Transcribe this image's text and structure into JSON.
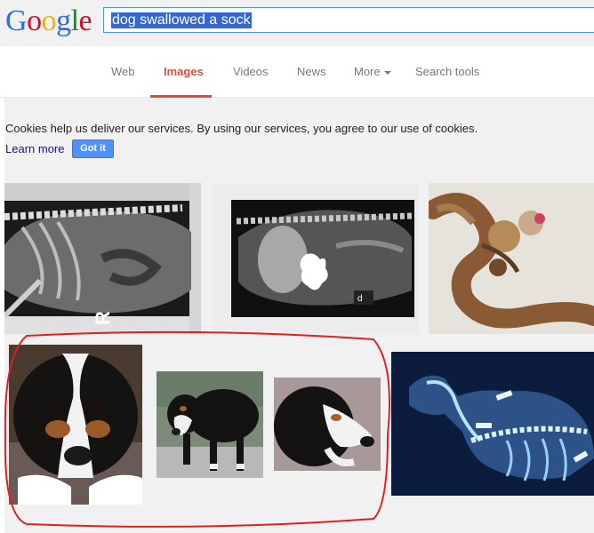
{
  "header": {
    "logo": {
      "G": "G",
      "o1": "o",
      "o2": "o",
      "g": "g",
      "l": "l",
      "e": "e"
    },
    "search": {
      "value": "dog swallowed a sock"
    }
  },
  "nav": {
    "items": [
      {
        "label": "Web"
      },
      {
        "label": "Images",
        "active": true
      },
      {
        "label": "Videos"
      },
      {
        "label": "News"
      },
      {
        "label": "More"
      },
      {
        "label": "Search tools"
      }
    ]
  },
  "cookie_notice": {
    "text": "Cookies help us deliver our services. By using our services, you agree to our use of cookies.",
    "learn_more": "Learn more",
    "got_it": "Got it"
  },
  "colors": {
    "accent_red": "#dd4b39",
    "link_blue": "#1a0dab",
    "button_blue": "#4d90fe",
    "annotation_red": "#e02020"
  },
  "results": [
    {
      "subject": "dog x-ray side view"
    },
    {
      "subject": "x-ray with sock mass"
    },
    {
      "subject": "extracted sock"
    },
    {
      "subject": "bernese puppy closeup"
    },
    {
      "subject": "bernese dog standing"
    },
    {
      "subject": "bernese dog head"
    },
    {
      "subject": "blue dog x-ray"
    }
  ]
}
